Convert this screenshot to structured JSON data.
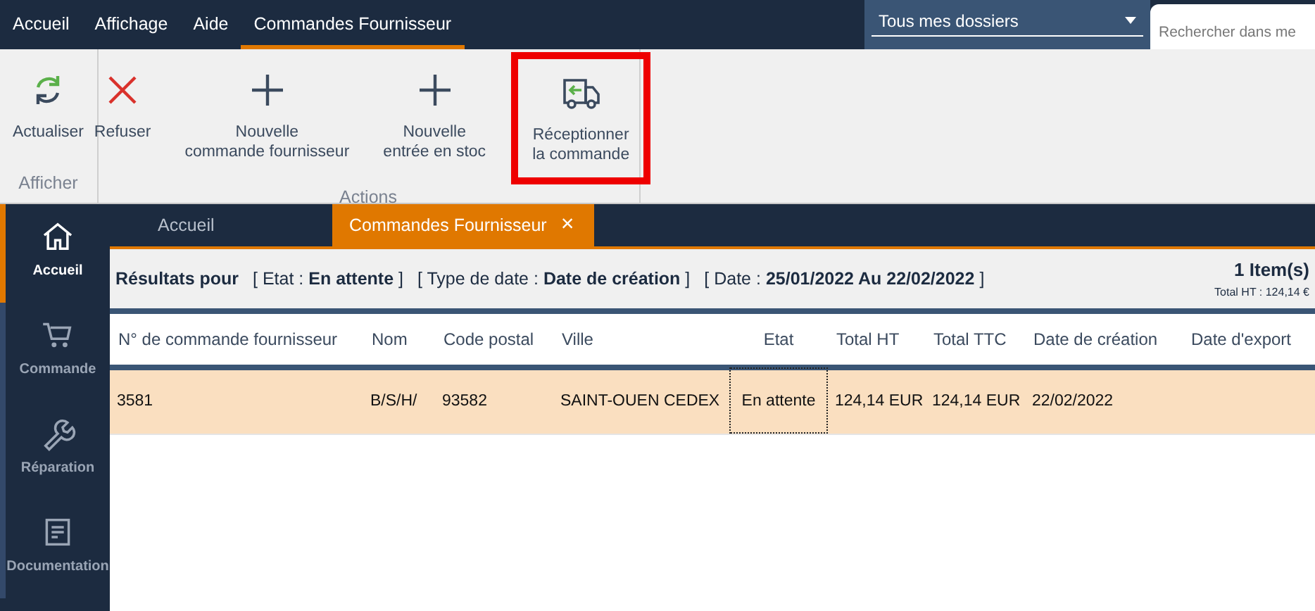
{
  "menu": [
    {
      "label": "Accueil",
      "selected": false
    },
    {
      "label": "Affichage",
      "selected": false
    },
    {
      "label": "Aide",
      "selected": false
    },
    {
      "label": "Commandes Fournisseur",
      "selected": true
    }
  ],
  "folder_dropdown": {
    "value": "Tous mes dossiers"
  },
  "search": {
    "placeholder": "Rechercher dans me"
  },
  "ribbon_groups": [
    {
      "label": "Afficher",
      "buttons": [
        {
          "kind": "refresh",
          "label": "Actualiser",
          "highlighted": false
        }
      ]
    },
    {
      "label": "Actions",
      "buttons": [
        {
          "kind": "cross",
          "label": "Refuser",
          "highlighted": false
        },
        {
          "kind": "plus",
          "label": "Nouvelle\ncommande fournisseur",
          "highlighted": false
        },
        {
          "kind": "plus",
          "label": "Nouvelle\nentrée en stoc",
          "highlighted": false
        },
        {
          "kind": "truck",
          "label": "Réceptionner\nla commande",
          "highlighted": true
        }
      ]
    }
  ],
  "sidebar": [
    {
      "kind": "home",
      "label": "Accueil",
      "selected": true
    },
    {
      "kind": "cart",
      "label": "Commande",
      "selected": false
    },
    {
      "kind": "wrench",
      "label": "Réparation",
      "selected": false
    },
    {
      "kind": "document",
      "label": "Documentation",
      "selected": false
    }
  ],
  "tabs": [
    {
      "label": "Accueil",
      "selected": false,
      "closable": false
    },
    {
      "label": "Commandes Fournisseur",
      "selected": true,
      "closable": true
    }
  ],
  "close_glyph": "×",
  "filter": {
    "title": "Résultats pour",
    "criteria": [
      "[ Etat : **En attente** ]",
      "[ Type de date : **Date de création** ]",
      "[ Date : **25/01/2022 Au 22/02/2022** ]"
    ],
    "count": "1 Item(s)",
    "total": "Total HT : 124,14 €"
  },
  "table": {
    "columns": [
      "N° de commande fournisseur",
      "Nom",
      "Code postal",
      "Ville",
      "Etat",
      "Total HT",
      "Total TTC",
      "Date de création",
      "Date d'export"
    ],
    "rows": [
      {
        "cells": [
          {
            "text": "3581",
            "focused": false
          },
          {
            "text": "B/S/H/",
            "focused": false
          },
          {
            "text": "93582",
            "focused": false
          },
          {
            "text": "SAINT-OUEN CEDEX",
            "focused": false
          },
          {
            "text": "En attente",
            "focused": true
          },
          {
            "text": "124,14 EUR",
            "focused": false
          },
          {
            "text": "124,14 EUR",
            "focused": false
          },
          {
            "text": "22/02/2022",
            "focused": false
          }
        ],
        "selected": true
      }
    ]
  }
}
